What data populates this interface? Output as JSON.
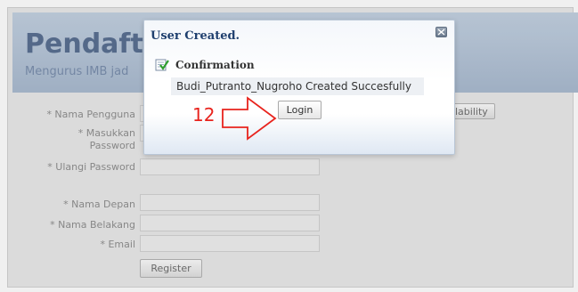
{
  "page": {
    "title": "Pendafta",
    "subtitle": "Mengurus IMB jad"
  },
  "form": {
    "username_label": "* Nama Pengguna",
    "password_label_line1": "* Masukkan",
    "password_label_line2": "Password",
    "confirm_password_label": "* Ulangi Password",
    "first_name_label": "* Nama Depan",
    "last_name_label": "* Nama Belakang",
    "email_label": "* Email",
    "availability_button": "lability",
    "register_button": "Register"
  },
  "dialog": {
    "title": "User Created.",
    "confirmation_label": "Confirmation",
    "message": "Budi_Putranto_Nugroho Created Succesfully",
    "login_button": "Login"
  },
  "annotation": {
    "step_number": "12",
    "arrow_color": "#e8231d"
  }
}
